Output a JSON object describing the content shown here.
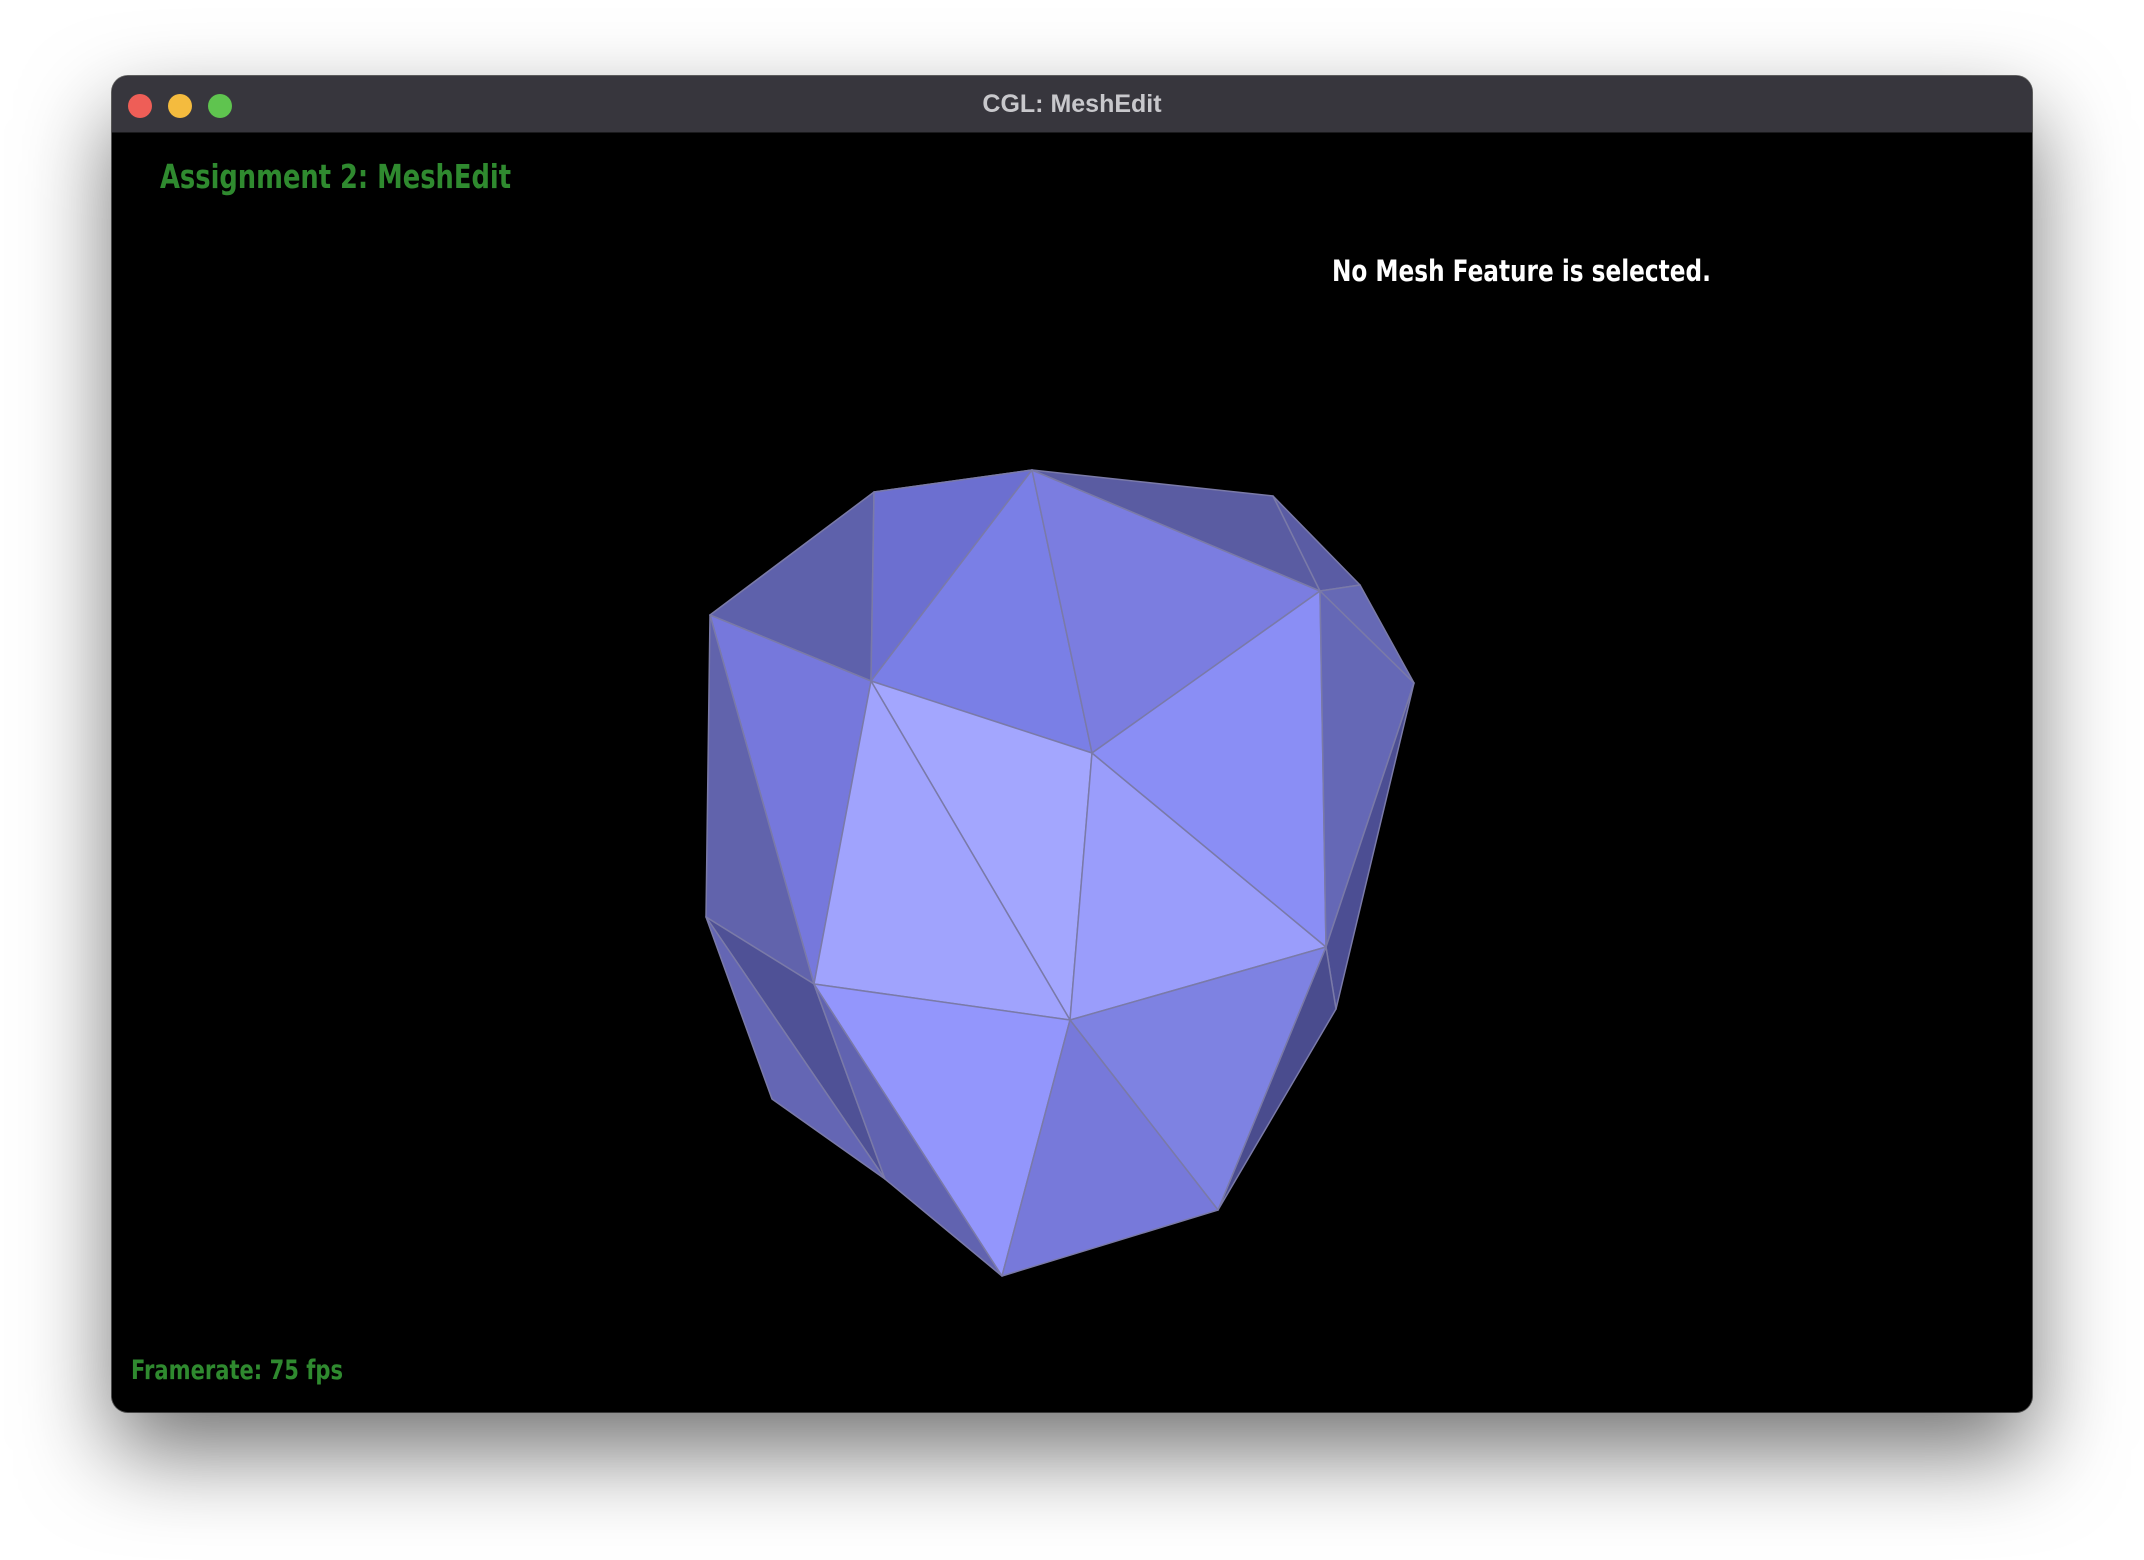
{
  "window": {
    "title": "CGL: MeshEdit",
    "controls": {
      "close_color": "#ee5e57",
      "minimize_color": "#f4bb3e",
      "zoom_color": "#5fc44f"
    }
  },
  "overlay": {
    "app_title": "Assignment 2: MeshEdit",
    "selection_status": "No Mesh Feature is selected.",
    "framerate": "Framerate: 75 fps"
  },
  "colors": {
    "overlay_green": "#2f8a2f",
    "overlay_white": "#ffffff",
    "mesh_base": "#8f93f5",
    "background": "#000000"
  },
  "viewport": {
    "object": "triangle-mesh",
    "face_count": 25
  }
}
